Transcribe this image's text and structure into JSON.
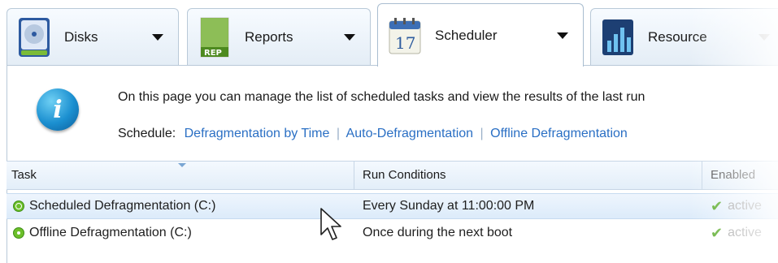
{
  "tabs": [
    {
      "label": "Disks",
      "icon": "disk-icon"
    },
    {
      "label": "Reports",
      "icon": "report-icon"
    },
    {
      "label": "Scheduler",
      "icon": "calendar-icon",
      "calendar_day": "17"
    },
    {
      "label": "Resource",
      "icon": "chart-icon"
    }
  ],
  "info": {
    "icon_glyph": "i",
    "text": "On this page you can manage the list of scheduled tasks and view the results of the last run",
    "schedule_label": "Schedule:",
    "links": [
      "Defragmentation by Time",
      "Auto-Defragmentation",
      "Offline Defragmentation"
    ],
    "link_separator": "|"
  },
  "grid": {
    "columns": [
      "Task",
      "Run Conditions",
      "Enabled"
    ],
    "rows": [
      {
        "task": "Scheduled Defragmentation (C:)",
        "conditions": "Every Sunday at 11:00:00 PM",
        "enabled": "active",
        "icon": "clock-icon",
        "selected": true
      },
      {
        "task": "Offline Defragmentation (C:)",
        "conditions": "Once during the next boot",
        "enabled": "active",
        "icon": "boot-icon",
        "selected": false
      }
    ]
  },
  "colors": {
    "link": "#2a6fc4",
    "active_check": "#4fa61c",
    "selection": "#dcebfa"
  }
}
